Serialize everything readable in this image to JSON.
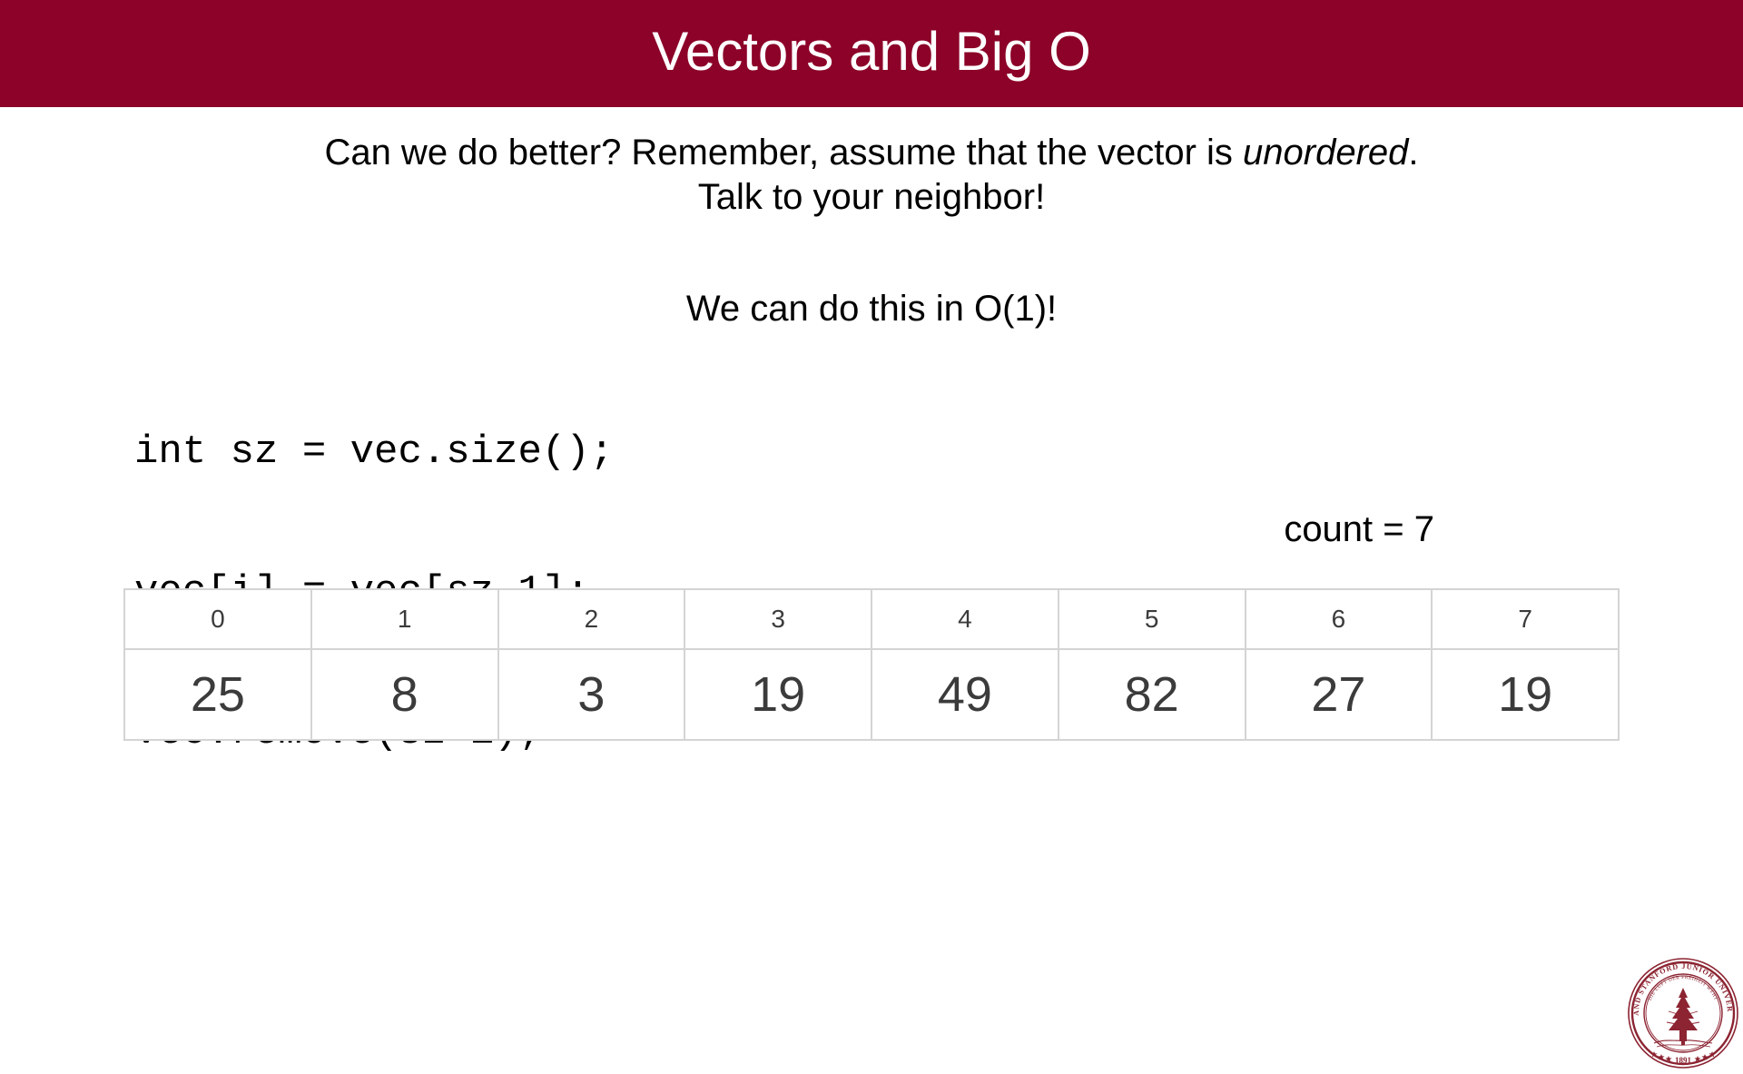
{
  "slide": {
    "title": "Vectors and Big O",
    "title_bar_color": "#8C0228",
    "background_color": "#FFFFFF"
  },
  "intro": {
    "line1_before_em": "Can we do better? Remember, assume that the vector is ",
    "line1_em": "unordered",
    "line1_after_em": ".",
    "line2": "Talk to your neighbor!"
  },
  "bigo": {
    "statement": "We can do this in O(1)!"
  },
  "code": {
    "lines": [
      "int sz = vec.size();",
      "vec[i] = vec[sz-1];",
      "vec.remove(sz-1);"
    ]
  },
  "count": {
    "label": "count = 7"
  },
  "vector_table": {
    "indices": [
      "0",
      "1",
      "2",
      "3",
      "4",
      "5",
      "6",
      "7"
    ],
    "values": [
      "25",
      "8",
      "3",
      "19",
      "49",
      "82",
      "27",
      "19"
    ],
    "faded_column_index": 7,
    "border_color": "#3A3526",
    "inner_border_color": "#D4D4D4",
    "text_color": "#3B3B3B",
    "faded_text_color": "#C6C6C6"
  },
  "seal": {
    "name": "stanford-university-seal",
    "outer_text": "LELAND STANFORD JUNIOR UNIVERSITY",
    "inner_text": "DIE LUFT DER FREIHEIT WEHT",
    "year": "1891",
    "color": "#8C2432"
  }
}
